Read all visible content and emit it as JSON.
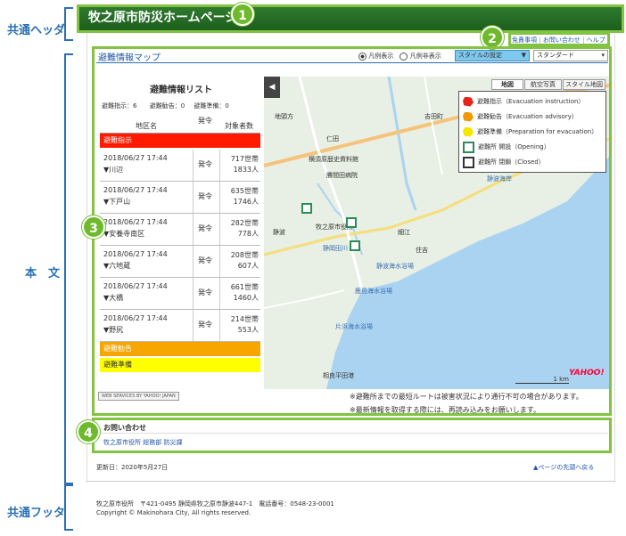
{
  "side_labels": {
    "header": "共通ヘッダ",
    "body": "本　文",
    "footer": "共通フッタ"
  },
  "header": {
    "title": "牧之原市防災ホームページ"
  },
  "badges": [
    "1",
    "2",
    "3",
    "4"
  ],
  "util_links": [
    "免責事項",
    "お問い合わせ",
    "ヘルプ"
  ],
  "map_section": {
    "title": "避難情報マップ",
    "legend_show": "凡例表示",
    "legend_hide": "凡例非表示",
    "style_select": "スタイルの設定",
    "style_value": "スタンダード"
  },
  "list": {
    "title": "避難情報リスト",
    "counts": {
      "shiji": "避難指示：6",
      "kankoku": "避難勧告：0",
      "junbi": "避難準備：0"
    },
    "col_area": "地区名",
    "col_issue": "発令",
    "col_target": "対象者数",
    "group_shiji": "避難指示",
    "group_kankoku": "避難勧告",
    "group_junbi": "避難準備",
    "rows": [
      {
        "date": "2018/06/27 17:44",
        "area": "▼川辺",
        "status": "発令",
        "households": "717世帯",
        "people": "1833人"
      },
      {
        "date": "2018/06/27 17:44",
        "area": "▼下戸山",
        "status": "発令",
        "households": "635世帯",
        "people": "1746人"
      },
      {
        "date": "2018/06/27 17:44",
        "area": "▼安養寺南区",
        "status": "発令",
        "households": "282世帯",
        "people": "778人"
      },
      {
        "date": "2018/06/27 17:44",
        "area": "▼六地蔵",
        "status": "発令",
        "households": "208世帯",
        "people": "607人"
      },
      {
        "date": "2018/06/27 17:44",
        "area": "▼大橋",
        "status": "発令",
        "households": "661世帯",
        "people": "1460人"
      },
      {
        "date": "2018/06/27 17:44",
        "area": "▼野尻",
        "status": "発令",
        "households": "214世帯",
        "people": "553人"
      }
    ]
  },
  "map": {
    "tabs": [
      "地図",
      "航空写真",
      "スタイル地図"
    ],
    "legend": [
      {
        "label": "避難指示（Evacuation instruction）",
        "color": "#e8231b"
      },
      {
        "label": "避難勧告（Evacuation advisory）",
        "color": "#f39800"
      },
      {
        "label": "避難準備（Preparation for evacuation）",
        "color": "#f5e600"
      },
      {
        "label": "避難所 開設（Opening）",
        "color": "#2e8b57"
      },
      {
        "label": "避難所 閉鎖（Closed）",
        "color": "#333333"
      }
    ],
    "places": [
      "地頭方",
      "牧之原市役所",
      "静波",
      "静岡田川",
      "静波海水浴場",
      "鹿島海水浴場",
      "片浜海水浴場",
      "相良平田港",
      "仁田",
      "横須原歴史資料館",
      "勝間田病院",
      "吉田町",
      "細江",
      "住吉",
      "静波海岸",
      "地頭方"
    ],
    "scale": "1 km",
    "yahoo": "YAHOO!",
    "credit": "WEB SERVICES BY YAHOO! JAPAN"
  },
  "notes": [
    "※避難所までの最短ルートは被害状況により通行不可の場合があります。",
    "※最新情報を取得する際には、再読み込みをお願いします。"
  ],
  "contact": {
    "title": "お問い合わせ",
    "link": "牧之原市役所 総務部 防災課"
  },
  "updated": "更新日：2020年5月27日",
  "back_to_top": "▲ページの先頭へ戻る",
  "footer": {
    "address": "牧之原市役所　〒421-0495 静岡県牧之原市静波447-1　電話番号：0548-23-0001",
    "copyright": "Copyright © Makinohara City, All rights reserved."
  }
}
